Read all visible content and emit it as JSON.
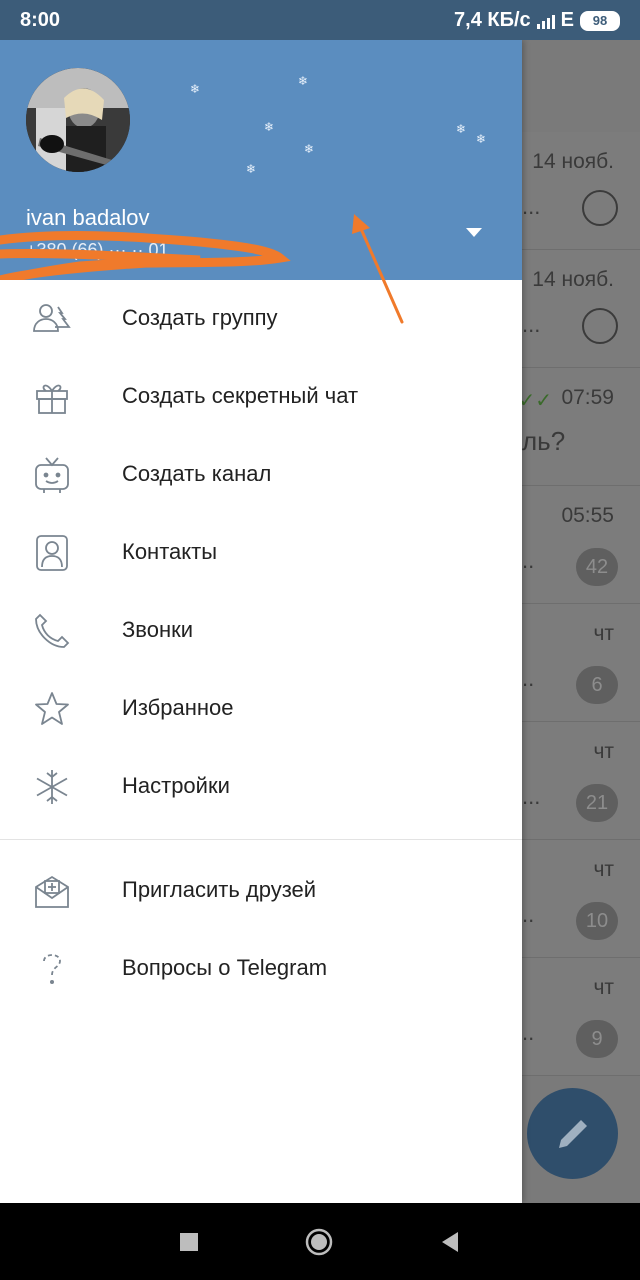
{
  "status_bar": {
    "time": "8:00",
    "speed": "7,4 КБ/с",
    "network": "E",
    "battery": "98"
  },
  "drawer": {
    "user_name": "ivan badalov",
    "user_phone": "+380 (66) ··· ·· 01",
    "menu": [
      {
        "label": "Создать группу",
        "icon": "group-icon"
      },
      {
        "label": "Создать секретный чат",
        "icon": "gift-lock-icon"
      },
      {
        "label": "Создать канал",
        "icon": "channel-tv-icon"
      },
      {
        "label": "Контакты",
        "icon": "contacts-icon"
      },
      {
        "label": "Звонки",
        "icon": "phone-icon"
      },
      {
        "label": "Избранное",
        "icon": "star-icon"
      },
      {
        "label": "Настройки",
        "icon": "snowflake-settings-icon"
      }
    ],
    "menu_secondary": [
      {
        "label": "Пригласить друзей",
        "icon": "invite-envelope-icon"
      },
      {
        "label": "Вопросы о Telegram",
        "icon": "question-icon"
      }
    ]
  },
  "chat_list_background": {
    "rows": [
      {
        "time": "14 нояб.",
        "snippet": "...",
        "pinned": true
      },
      {
        "time": "14 нояб.",
        "snippet": "...",
        "pinned": true
      },
      {
        "time": "07:59",
        "snippet": "ль?",
        "read": true
      },
      {
        "time": "05:55",
        "snippet": "..",
        "badge": "42"
      },
      {
        "time": "чт",
        "snippet": "..",
        "badge": "6"
      },
      {
        "time": "чт",
        "snippet": "...",
        "badge": "21"
      },
      {
        "time": "чт",
        "snippet": "..",
        "badge": "10"
      },
      {
        "time": "чт",
        "snippet": "..",
        "badge": "9"
      }
    ]
  },
  "colors": {
    "header": "#5b8dbf",
    "status": "#3c5c79",
    "accent_arrow": "#f07a2b"
  }
}
